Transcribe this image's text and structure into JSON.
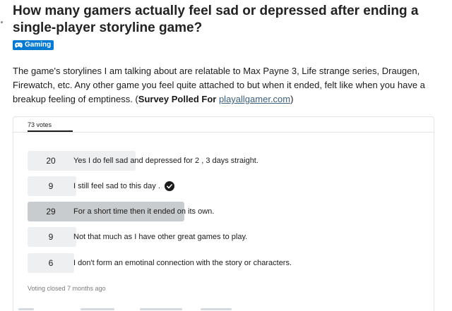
{
  "post": {
    "title": "How many gamers actually feel sad or depressed after ending a single-player storyline game?",
    "flair": {
      "label": "Gaming",
      "icon": "gamepad-icon",
      "color": "#0079d3"
    },
    "body_text": "The game's storylines I am talking about are relatable to Max Payne 3, Life strange series, Draugen, Firewatch, etc. Any other game you feel quite attached to but when it ended, felt like when you have a breakup feeling of emptiness. (",
    "body_bold": "Survey Polled For",
    "body_link": "playallgamer.com",
    "body_end": ")"
  },
  "poll": {
    "total_votes_label": "73 votes",
    "total_votes": 73,
    "options": [
      {
        "count": "20",
        "votes": 20,
        "label": "Yes I do fell sad and depressed for 2 , 3 days straight.",
        "selected": false,
        "winner": false
      },
      {
        "count": "9",
        "votes": 9,
        "label": "I still feel sad to this day .",
        "selected": true,
        "winner": false
      },
      {
        "count": "29",
        "votes": 29,
        "label": "For a short time then it ended on its own.",
        "selected": false,
        "winner": true
      },
      {
        "count": "9",
        "votes": 9,
        "label": "Not that much as I have other great games to play.",
        "selected": false,
        "winner": false
      },
      {
        "count": "6",
        "votes": 6,
        "label": "I don't form an emotinal connection with the story or characters.",
        "selected": false,
        "winner": false
      }
    ],
    "status": "Voting closed 7 months ago"
  },
  "colors": {
    "bar": "#edeff1",
    "winner_bar": "#c9ccce",
    "link": "#3d5f7a"
  }
}
